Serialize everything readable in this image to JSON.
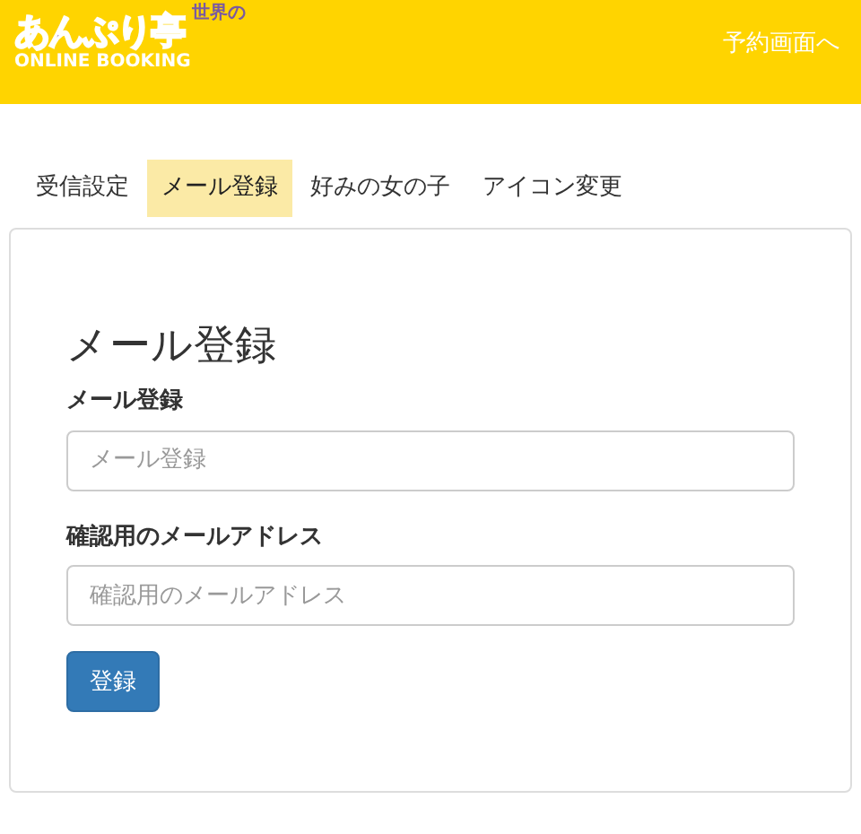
{
  "header": {
    "logo": {
      "top": "世界の",
      "main": "あんぷり亭",
      "sub": "ONLINE BOOKING"
    },
    "link": "予約画面へ"
  },
  "tabs": [
    {
      "label": "受信設定",
      "selected": false
    },
    {
      "label": "メール登録",
      "selected": true
    },
    {
      "label": "好みの女の子",
      "selected": false
    },
    {
      "label": "アイコン変更",
      "selected": false
    }
  ],
  "form": {
    "title": "メール登録",
    "fields": [
      {
        "label": "メール登録",
        "placeholder": "メール登録"
      },
      {
        "label": "確認用のメールアドレス",
        "placeholder": "確認用のメールアドレス"
      }
    ],
    "submit": "登録"
  }
}
